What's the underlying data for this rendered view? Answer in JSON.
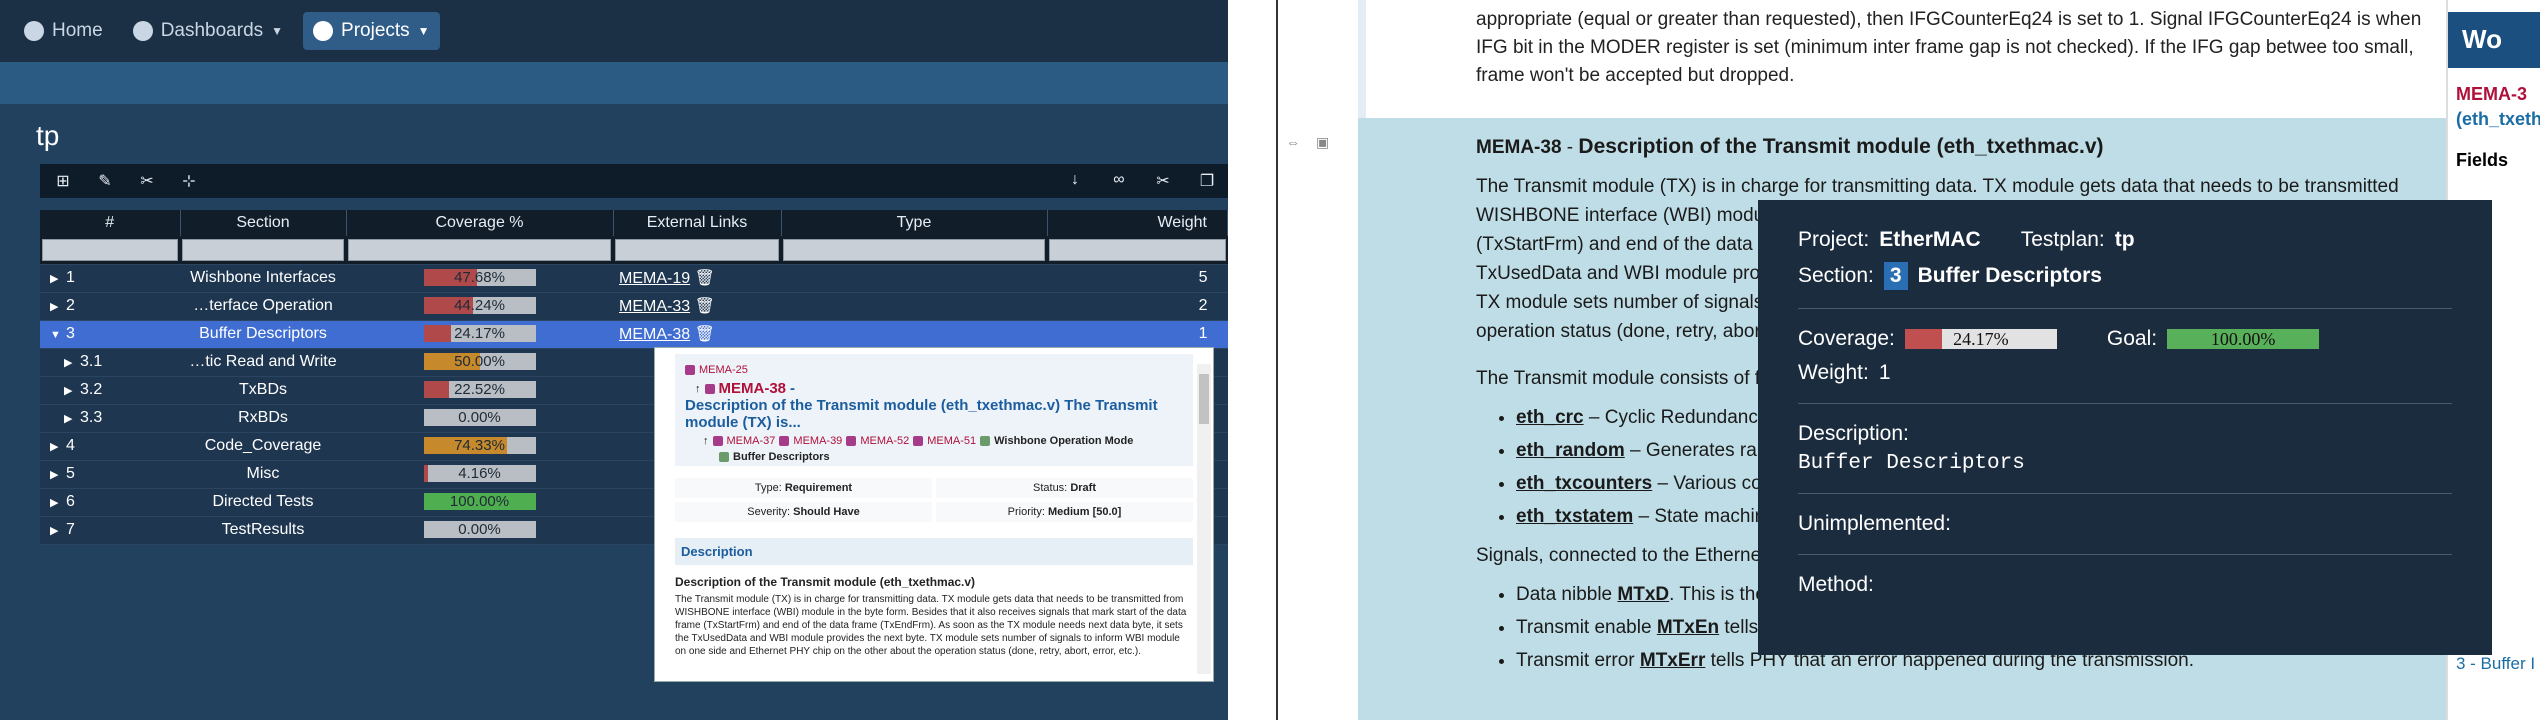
{
  "left": {
    "nav": {
      "home": "Home",
      "dashboards": "Dashboards",
      "projects": "Projects"
    },
    "page_title": "tp",
    "columns": [
      "#",
      "Section",
      "Coverage %",
      "External Links",
      "Type",
      "Weight"
    ],
    "rows": [
      {
        "num": "1",
        "section": "Wishbone Interfaces",
        "coverage": "47.68%",
        "cov_frac": 0.4768,
        "color": "#b04a4a",
        "link": "MEMA-19",
        "weight": "5",
        "indent": false
      },
      {
        "num": "2",
        "section": "…terface Operation",
        "coverage": "44.24%",
        "cov_frac": 0.4424,
        "color": "#b04a4a",
        "link": "MEMA-33",
        "weight": "2",
        "indent": false
      },
      {
        "num": "3",
        "section": "Buffer Descriptors",
        "coverage": "24.17%",
        "cov_frac": 0.2417,
        "color": "#b04a4a",
        "link": "MEMA-38",
        "weight": "1",
        "indent": false
      },
      {
        "num": "3.1",
        "section": "…tic Read and Write",
        "coverage": "50.00%",
        "cov_frac": 0.5,
        "color": "#c6892c",
        "link": "",
        "weight": "",
        "indent": true
      },
      {
        "num": "3.2",
        "section": "TxBDs",
        "coverage": "22.52%",
        "cov_frac": 0.2252,
        "color": "#b04a4a",
        "link": "",
        "weight": "",
        "indent": true
      },
      {
        "num": "3.3",
        "section": "RxBDs",
        "coverage": "0.00%",
        "cov_frac": 0,
        "color": "#b04a4a",
        "link": "",
        "weight": "",
        "indent": true
      },
      {
        "num": "4",
        "section": "Code_Coverage",
        "coverage": "74.33%",
        "cov_frac": 0.7433,
        "color": "#c6892c",
        "link": "",
        "weight": "",
        "indent": false
      },
      {
        "num": "5",
        "section": "Misc",
        "coverage": "4.16%",
        "cov_frac": 0.0416,
        "color": "#b04a4a",
        "link": "",
        "weight": "",
        "indent": false
      },
      {
        "num": "6",
        "section": "Directed Tests",
        "coverage": "100.00%",
        "cov_frac": 1,
        "color": "#4fae4f",
        "link": "",
        "weight": "",
        "indent": false
      },
      {
        "num": "7",
        "section": "TestResults",
        "coverage": "0.00%",
        "cov_frac": 0,
        "color": "#b04a4a",
        "link": "",
        "weight": "",
        "indent": false
      }
    ],
    "popup": {
      "parent": "MEMA-25",
      "id": "MEMA-38",
      "title": "Description of the Transmit module (eth_txethmac.v) The Transmit module (TX) is...",
      "children": [
        "MEMA-37",
        "MEMA-39",
        "MEMA-52",
        "MEMA-51"
      ],
      "child_extra": "Wishbone Operation Mode",
      "child_extra2": "Buffer Descriptors",
      "type_label": "Type:",
      "type_val": "Requirement",
      "status_label": "Status:",
      "status_val": "Draft",
      "severity_label": "Severity:",
      "severity_val": "Should Have",
      "priority_label": "Priority:",
      "priority_val": "Medium [50.0]",
      "desc_header": "Description",
      "desc_title": "Description of the Transmit module (eth_txethmac.v)",
      "desc_text": "The Transmit module (TX) is in charge for transmitting data. TX module gets data that needs to be transmitted from WISHBONE interface (WBI) module in the byte form. Besides that it also receives signals that mark start of the data frame (TxStartFrm) and end of the data frame (TxEndFrm). As soon as the TX module needs next data byte, it sets the TxUsedData and WBI module provides the next byte. TX module sets number of signals to inform WBI module on one side and Ethernet PHY chip on the other about the operation status (done, retry, abort, error, etc.)."
    }
  },
  "right": {
    "top_text": "appropriate (equal or greater than requested), then IFGCounterEq24 is set to 1. Signal IFGCounterEq24 is when IFG bit in the MODER register is set (minimum inter frame gap is not checked). If the IFG gap betwee too small, frame won't be accepted but dropped.",
    "heading_id": "MEMA-38",
    "heading": "Description of the Transmit module (eth_txethmac.v)",
    "para1": "The Transmit module (TX) is in charge for transmitting data. TX module gets data that needs to be transmitted",
    "para1b": "WISHBONE interface (WBI) module i",
    "para1c": "(TxStartFrm) and end of the data fr",
    "para1d": "TxUsedData and WBI module provi",
    "para1e": "TX module sets number of signals to",
    "para1f": "operation status (done, retry, abort,",
    "para2": "The Transmit module consists of fou",
    "list": [
      {
        "k": "eth_crc",
        "v": " – Cyclic Redundancy C"
      },
      {
        "k": "eth_random",
        "v": " – Generates rando"
      },
      {
        "k": "eth_txcounters",
        "v": " – Various cou"
      },
      {
        "k": "eth_txstatem",
        "v": " – State machine"
      }
    ],
    "para3": "Signals, connected to the Ethernet P",
    "sig": [
      {
        "a": "Data nibble ",
        "k": "MTxD",
        "b": ". This is the"
      },
      {
        "a": "Transmit enable ",
        "k": "MTxEn",
        "b": " tells PHY that data MTxD is valid and transmission should start."
      },
      {
        "a": "Transmit error ",
        "k": "MTxErr",
        "b": " tells PHY that an error happened during the transmission."
      }
    ],
    "tooltip": {
      "project_label": "Project:",
      "project": "EtherMAC",
      "testplan_label": "Testplan:",
      "testplan": "tp",
      "section_label": "Section:",
      "section_num": "3",
      "section": "Buffer Descriptors",
      "coverage_label": "Coverage:",
      "coverage": "24.17%",
      "coverage_frac": 0.2417,
      "goal_label": "Goal:",
      "goal": "100.00%",
      "goal_frac": 1,
      "weight_label": "Weight:",
      "weight": "1",
      "description_label": "Description:",
      "description": "Buffer Descriptors",
      "unimplemented_label": "Unimplemented:",
      "method_label": "Method:"
    },
    "side": {
      "wbox": "Wo",
      "link1": "MEMA-3",
      "link2": "(eth_txethm",
      "fields": "Fields",
      "extra": "3 - Buffer I"
    }
  }
}
